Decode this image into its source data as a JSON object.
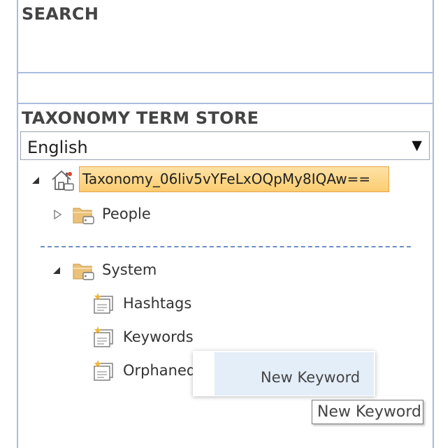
{
  "search": {
    "title": "SEARCH"
  },
  "term_store": {
    "title": "TAXONOMY TERM STORE",
    "language_select": {
      "selected": "English"
    }
  },
  "tree": {
    "root": {
      "label": "Taxonomy_06liv5vYFeLxOQpMy8IQAw==",
      "expanded": true,
      "icon": "home-icon"
    },
    "groups": [
      {
        "label": "People",
        "expanded": false,
        "icon": "folder-tag-icon"
      },
      {
        "label": "System",
        "expanded": true,
        "icon": "folder-tag-icon",
        "term_sets": [
          {
            "label": "Hashtags",
            "icon": "term-set-icon"
          },
          {
            "label": "Keywords",
            "icon": "term-set-icon"
          },
          {
            "label": "Orphaned",
            "icon": "term-set-icon"
          }
        ]
      }
    ]
  },
  "context_menu": {
    "items": [
      {
        "label": "New Keyword"
      }
    ]
  },
  "tooltip": {
    "text": "New Keyword"
  },
  "colors": {
    "panel_border": "#a9bcdf",
    "selected_fill": "#fbcd6f",
    "selected_border": "#e9a24a",
    "menu_hover": "#e4eef8",
    "folder": "#e8b96a"
  }
}
